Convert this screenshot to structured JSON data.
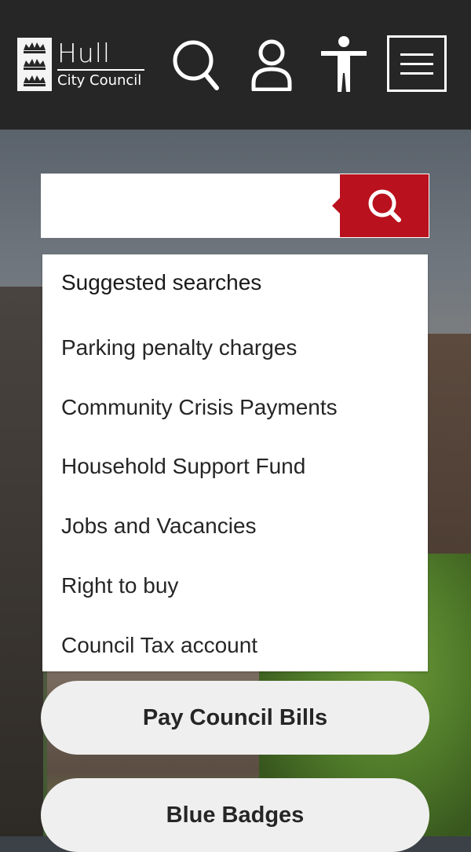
{
  "header": {
    "logo_title": "Hull",
    "logo_subtitle": "City Council",
    "icons": {
      "search": "search-icon",
      "account": "user-icon",
      "accessibility": "accessibility-icon",
      "menu": "hamburger-menu-icon",
      "logo": "three-crowns-crest"
    }
  },
  "search": {
    "value": "",
    "placeholder": "",
    "submit_icon": "search-icon"
  },
  "suggestions": {
    "heading": "Suggested searches",
    "items": [
      "Parking penalty charges",
      "Community Crisis Payments",
      "Household Support Fund",
      "Jobs and Vacancies",
      "Right to buy",
      "Council Tax account"
    ]
  },
  "quick_links": [
    "Pay Council Bills",
    "Blue Badges"
  ],
  "colors": {
    "header_bg": "#262626",
    "accent_red": "#b9111d",
    "pill_bg": "#efefef",
    "text": "#262626"
  }
}
